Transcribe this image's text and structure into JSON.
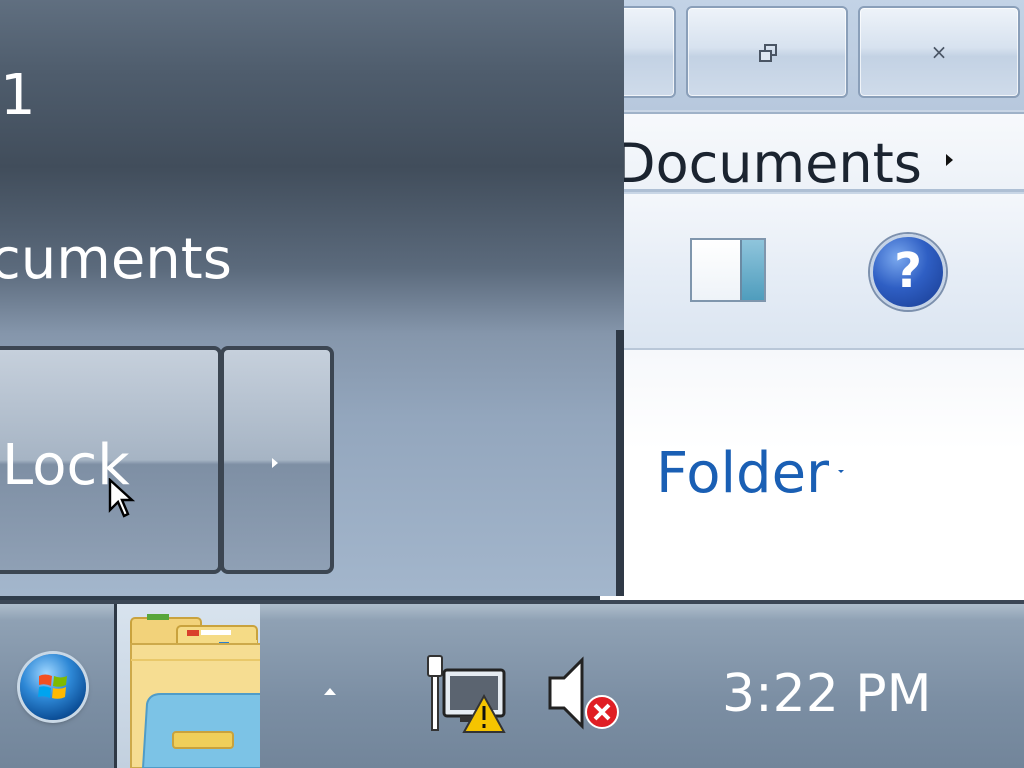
{
  "explorer": {
    "address_current": "Documents",
    "new_folder_label": "Folder",
    "help_glyph": "?",
    "caption_icons": {
      "restore": "restore-icon",
      "close": "close-icon"
    },
    "close_glyph": "×"
  },
  "start_menu": {
    "user_label": "1",
    "documents_label": "cuments",
    "lock_label": "Lock"
  },
  "taskbar": {
    "clock": "3:22 PM",
    "tray_icons": [
      "show-hidden-icons-arrow",
      "network-warning-icon",
      "volume-muted-icon"
    ],
    "pinned": [
      "windows-explorer"
    ]
  },
  "colors": {
    "link_blue": "#1a5fb4",
    "warning_yellow": "#f5c400",
    "error_red": "#e01e24"
  }
}
